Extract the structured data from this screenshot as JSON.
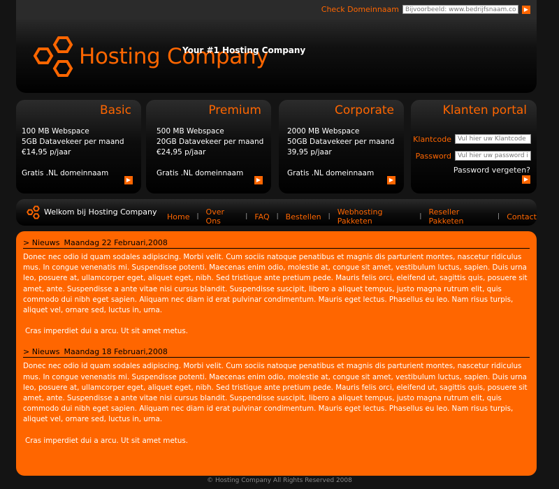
{
  "domain_check": {
    "label": "Check Domeinnaam",
    "placeholder": "Bijvoorbeeld: www.bedrijfsnaam.com"
  },
  "header": {
    "brand": "Hosting Company",
    "tagline": "Your #1 Hosting Company"
  },
  "packages": [
    {
      "title": "Basic",
      "lines": [
        "100 MB Webspace",
        "5GB Datavekeer per maand",
        "€14,95 p/jaar"
      ],
      "extra": "Gratis .NL domeinnaam"
    },
    {
      "title": "Premium",
      "lines": [
        "500 MB Webspace",
        "20GB Datavekeer per maand",
        "€24,95 p/jaar"
      ],
      "extra": "Gratis .NL domeinnaam"
    },
    {
      "title": "Corporate",
      "lines": [
        "2000 MB Webspace",
        "50GB Datavekeer per maand",
        "39,95 p/jaar"
      ],
      "extra": "Gratis .NL domeinnaam"
    }
  ],
  "portal": {
    "title": "Klanten portal",
    "klantcode_label": "Klantcode",
    "klantcode_placeholder": "Vul hier uw Klantcode in",
    "password_label": "Password",
    "password_placeholder": "Vul hier uw password in",
    "forgot": "Password vergeten?"
  },
  "nav": {
    "welcome": "Welkom bij Hosting Company",
    "items": [
      "Home",
      "Over Ons",
      "FAQ",
      "Bestellen",
      "Webhosting Pakketen",
      "Reseller Pakketen",
      "Contact"
    ]
  },
  "news": [
    {
      "label": "> Nieuws",
      "date": "Maandag 22 Februari,2008",
      "body": "Donec nec odio id quam sodales adipiscing. Morbi velit. Cum sociis natoque penatibus et magnis dis parturient montes, nascetur ridiculus mus. In congue venenatis mi. Suspendisse potenti. Maecenas enim odio, molestie at, congue sit amet, vestibulum luctus, sapien. Duis urna leo, posuere at, ullamcorper eget, aliquet eget, nibh. Sed tristique ante pretium pede. Mauris felis orci, eleifend ut, sagittis quis, posuere sit amet, ante. Suspendisse a ante vitae nisi cursus blandit. Suspendisse suscipit, libero a aliquet tempus, justo magna rutrum elit, quis commodo dui nibh eget sapien. Aliquam nec diam id erat pulvinar condimentum. Mauris eget lectus. Phasellus eu leo. Nam risus turpis, aliquet vel, ornare sed, luctus in, urna.",
      "body2": "Cras imperdiet dui a arcu. Ut sit amet metus."
    },
    {
      "label": "> Nieuws",
      "date": "Maandag 18 Februari,2008",
      "body": "Donec nec odio id quam sodales adipiscing. Morbi velit. Cum sociis natoque penatibus et magnis dis parturient montes, nascetur ridiculus mus. In congue venenatis mi. Suspendisse potenti. Maecenas enim odio, molestie at, congue sit amet, vestibulum luctus, sapien. Duis urna leo, posuere at, ullamcorper eget, aliquet eget, nibh. Sed tristique ante pretium pede. Mauris felis orci, eleifend ut, sagittis quis, posuere sit amet, ante. Suspendisse a ante vitae nisi cursus blandit. Suspendisse suscipit, libero a aliquet tempus, justo magna rutrum elit, quis commodo dui nibh eget sapien. Aliquam nec diam id erat pulvinar condimentum. Mauris eget lectus. Phasellus eu leo. Nam risus turpis, aliquet vel, ornare sed, luctus in, urna.",
      "body2": "Cras imperdiet dui a arcu. Ut sit amet metus."
    }
  ],
  "footer": "© Hosting Company All Rights Reserved 2008",
  "icons": {
    "arrow": "arrow-right-icon",
    "logo": "hexagon-logo-icon"
  },
  "colors": {
    "accent": "#ff6600",
    "background": "#141414"
  }
}
